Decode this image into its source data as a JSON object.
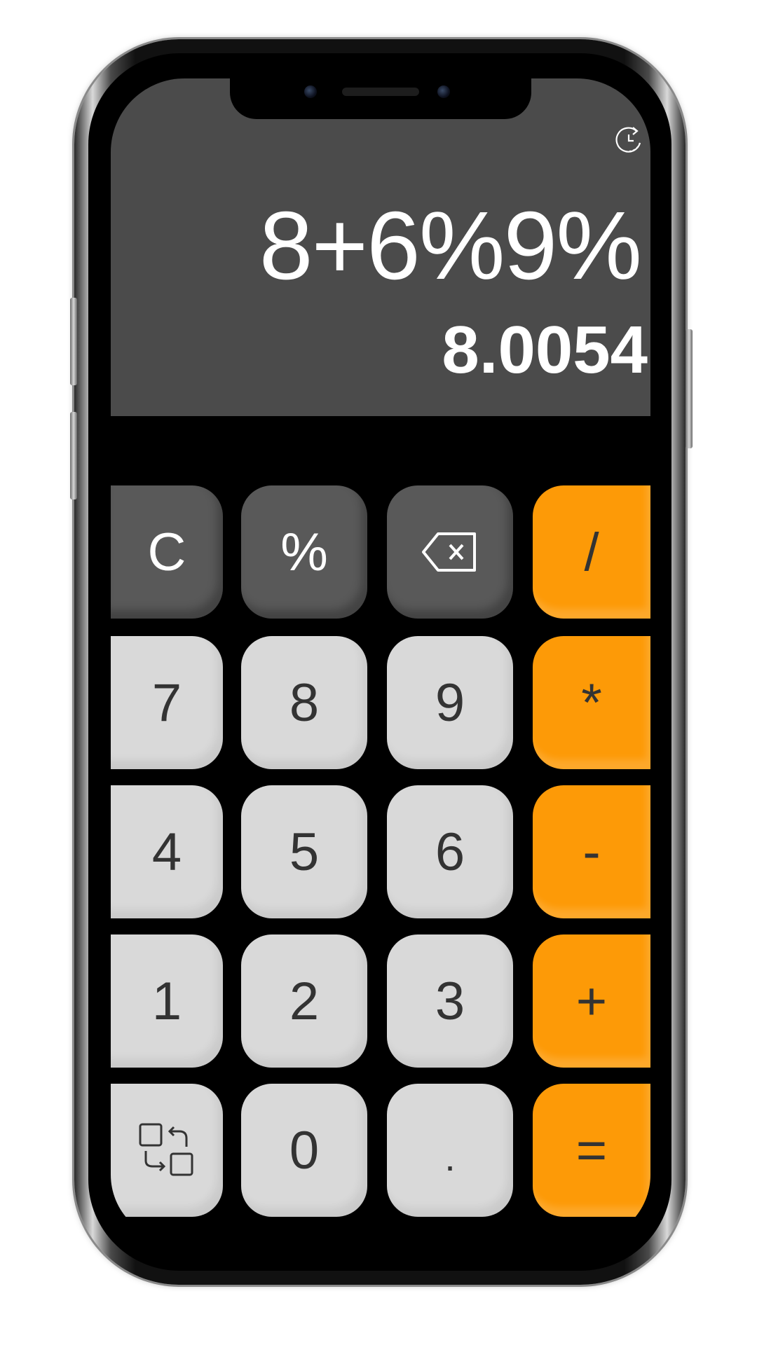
{
  "display": {
    "expression": "8+6%9%",
    "result": "8.0054"
  },
  "header": {
    "history_icon": "history-clock-icon"
  },
  "keypad": {
    "row1": [
      "C",
      "%",
      "backspace",
      "/"
    ],
    "row2": [
      "7",
      "8",
      "9",
      "*"
    ],
    "row3": [
      "4",
      "5",
      "6",
      "-"
    ],
    "row4": [
      "1",
      "2",
      "3",
      "+"
    ],
    "row5": [
      "swap",
      "0",
      ".",
      "="
    ],
    "labels": {
      "clear": "C",
      "percent": "%",
      "divide": "/",
      "multiply": "*",
      "subtract": "-",
      "add": "+",
      "equals": "=",
      "seven": "7",
      "eight": "8",
      "nine": "9",
      "four": "4",
      "five": "5",
      "six": "6",
      "one": "1",
      "two": "2",
      "three": "3",
      "zero": "0",
      "decimal": "."
    },
    "icons": {
      "backspace": "backspace-icon",
      "swap": "swap-icon"
    }
  },
  "colors": {
    "display_bg": "#4b4b4b",
    "function_key": "#595959",
    "number_key": "#d9d9d9",
    "operator_key": "#fd9a07",
    "text_light": "#ffffff",
    "text_dark": "#333333"
  }
}
